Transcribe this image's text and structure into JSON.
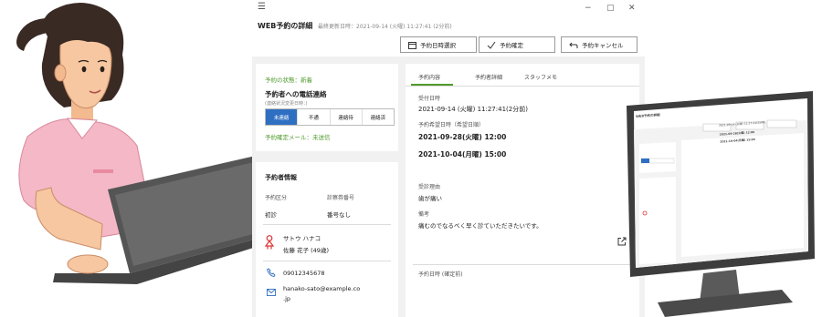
{
  "window": {
    "menu_icon": "hamburger-icon",
    "title": "WEB予約の詳細",
    "updated": "最終更新日時：2021-09-14 (火曜) 11:27:41 (2分前)"
  },
  "toolbar": {
    "select_datetime": "予約日時選択",
    "confirm": "予約確定",
    "cancel": "予約キャンセル"
  },
  "status_card": {
    "status": "予約の状態：新着",
    "phone_title": "予約者への電話連絡",
    "phone_sub": "(連絡状況変更日時：)",
    "phone_options": [
      "未連絡",
      "不通",
      "連絡待",
      "連絡済"
    ],
    "selected_option": 0,
    "mail_status": "予約確定メール：未送信"
  },
  "patient": {
    "section_title": "予約者情報",
    "category_label": "予約区分",
    "card_label": "診察券番号",
    "category_value": "初診",
    "card_value": "番号なし",
    "name_kana": "サトウ ハナコ",
    "name": "佐藤 花子 (49歳)",
    "phone": "09012345678",
    "email_line1": "hanako-sato@example.co",
    "email_line2": ".jp"
  },
  "detail": {
    "tabs": [
      "予約内容",
      "予約者詳細",
      "スタッフメモ"
    ],
    "active_tab": 0,
    "received_label": "受付日時",
    "received_value": "2021-09-14 (火曜) 11:27:41(2分前)",
    "wish_label": "予約希望日時（希望日順）",
    "wish_1": "2021-09-28(火曜) 12:00",
    "wish_2": "2021-10-04(月曜) 15:00",
    "reason_label": "受診理由",
    "reason_value": "歯が痛い",
    "note_label": "備考",
    "note_value": "痛むのでなるべく早く診ていただきたいです。",
    "fixed_label": "予約日時 (確定前)"
  },
  "monitor_screen": {
    "title": "WEB予約の詳細",
    "received_value": "2021-09-14 (火曜) 11:27:41(2分前)",
    "wish_1": "2021-09-28(火曜) 12:00",
    "wish_2": "2021-10-04(月曜) 15:00"
  },
  "colors": {
    "accent_green": "#4f9a2c",
    "selected_blue": "#2f6fc2",
    "panel_gray": "#f1f1f1",
    "skin": "#f6c7a0",
    "shirt": "#f4b8c6",
    "laptop": "#555555"
  }
}
